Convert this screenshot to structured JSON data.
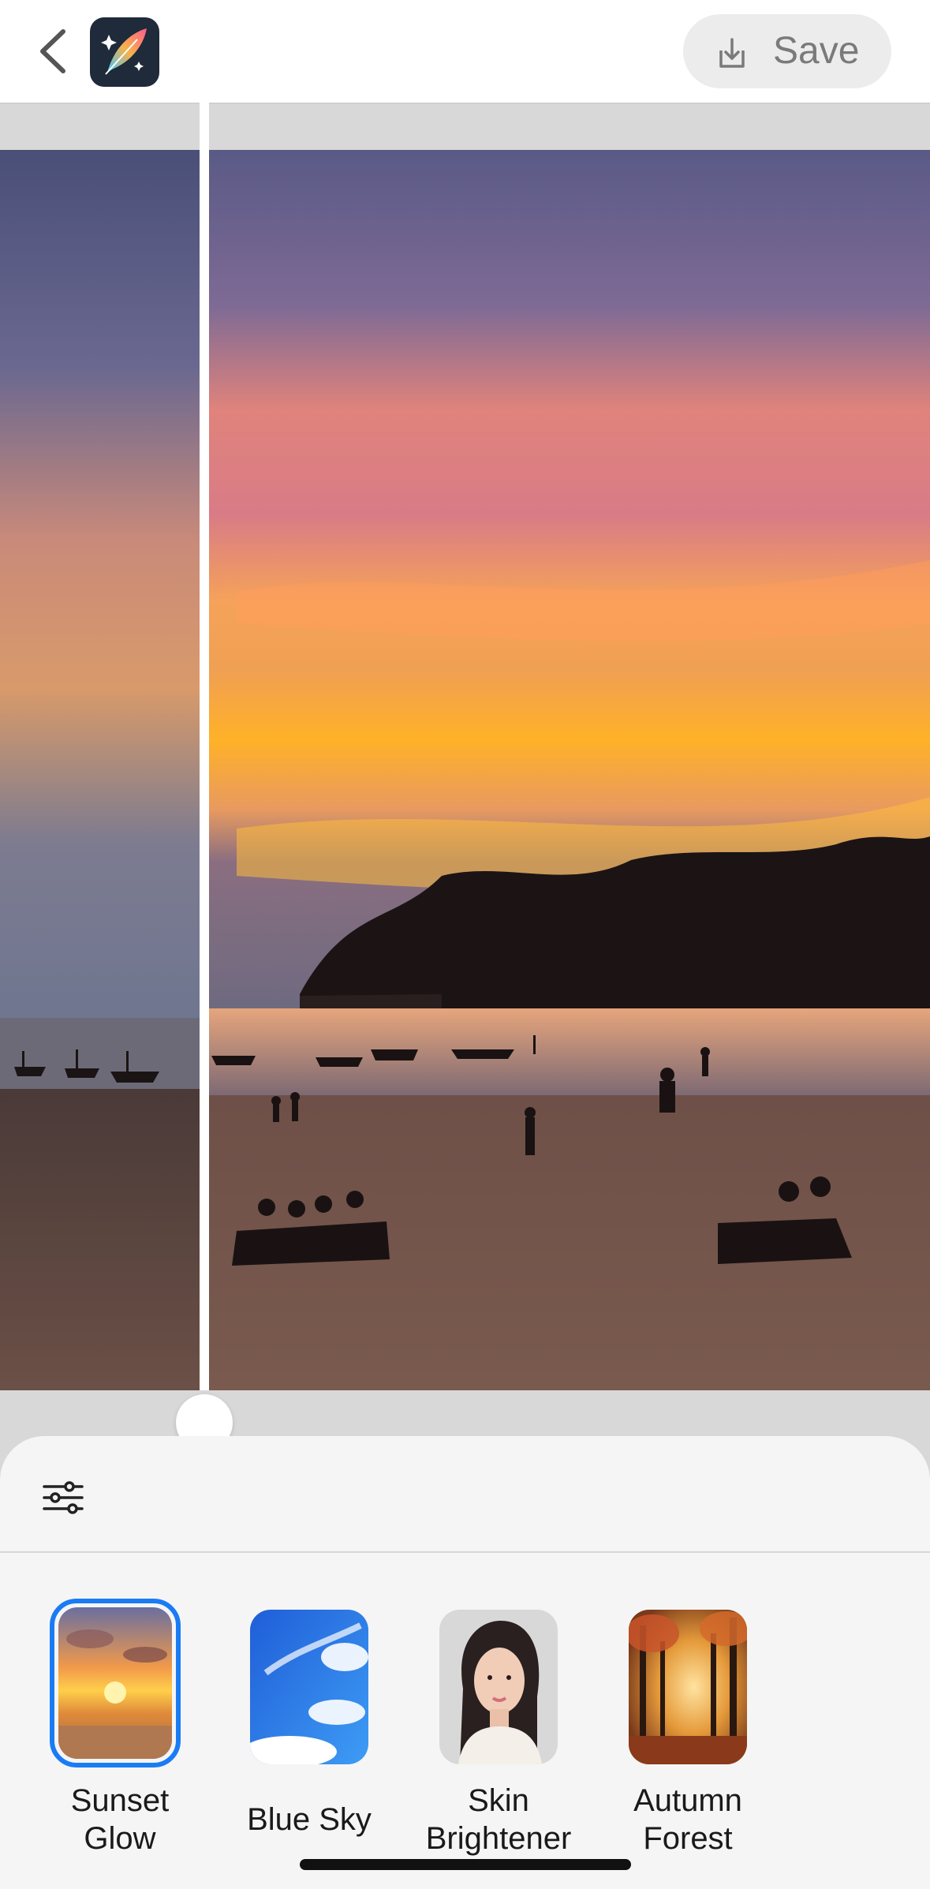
{
  "header": {
    "back_icon": "chevron-left-icon",
    "app_logo_icon": "feather-sparkle-icon",
    "save_label": "Save",
    "save_icon": "download-tray-icon"
  },
  "photo": {
    "description_icon_play": "play-icon",
    "description_icon_compare": "split-view-icon",
    "before_after_split": 0.22
  },
  "sheet": {
    "adjust_icon": "sliders-icon",
    "selected_color": "#1a7cf5",
    "presets": [
      {
        "label": "Sunset\nGlow",
        "selected": true
      },
      {
        "label": "Blue Sky",
        "selected": false
      },
      {
        "label": "Skin\nBrightener",
        "selected": false
      },
      {
        "label": "Autumn\nForest",
        "selected": false
      }
    ]
  }
}
